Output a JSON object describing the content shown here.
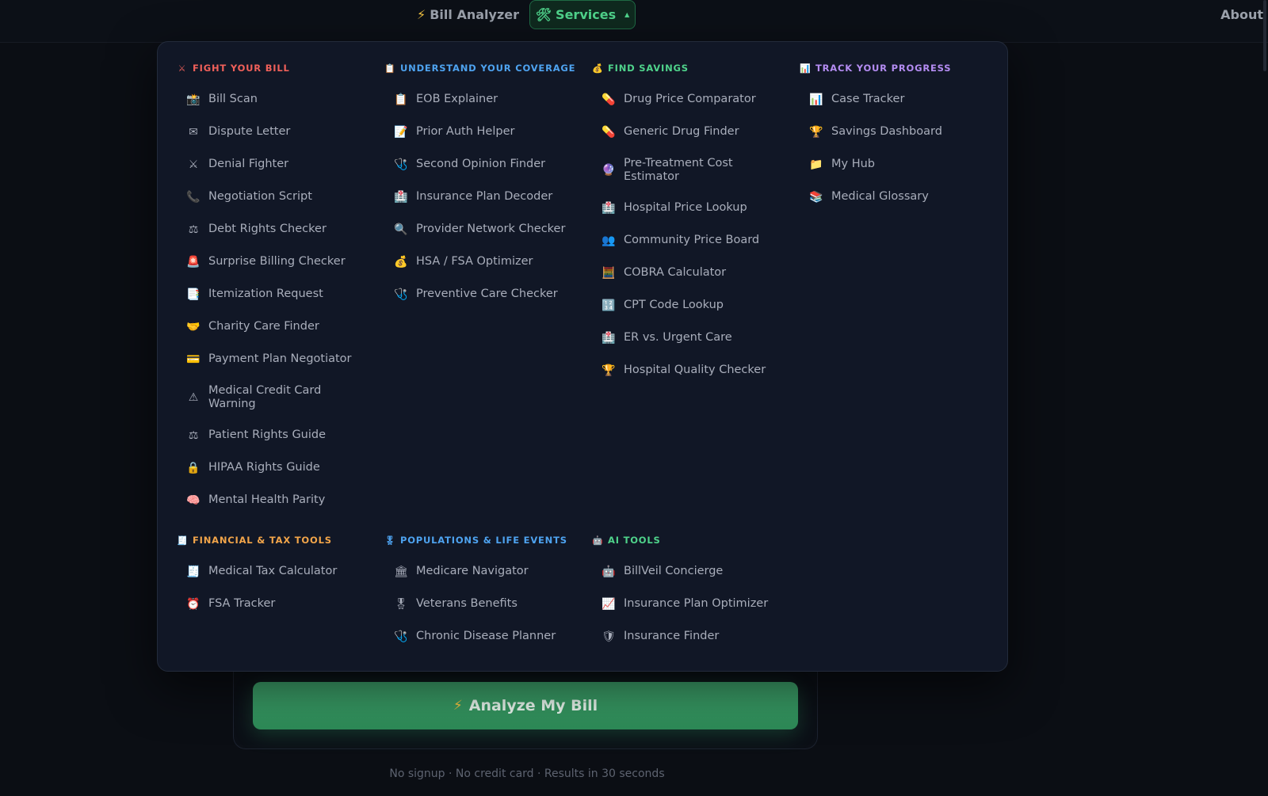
{
  "nav": {
    "bill_icon": "⚡",
    "bill_label": "Bill Analyzer",
    "services_icon": "🛠",
    "services_label": "Services",
    "about_label": "About"
  },
  "menu": {
    "fight": {
      "icon": "⚔",
      "title": "FIGHT YOUR BILL",
      "color": "#f0605a",
      "items": [
        {
          "icon": "📸",
          "label": "Bill Scan"
        },
        {
          "icon": "✉",
          "label": "Dispute Letter"
        },
        {
          "icon": "⚔",
          "label": "Denial Fighter"
        },
        {
          "icon": "📞",
          "label": "Negotiation Script"
        },
        {
          "icon": "⚖",
          "label": "Debt Rights Checker"
        },
        {
          "icon": "🚨",
          "label": "Surprise Billing Checker"
        },
        {
          "icon": "📑",
          "label": "Itemization Request"
        },
        {
          "icon": "🤝",
          "label": "Charity Care Finder"
        },
        {
          "icon": "💳",
          "label": "Payment Plan Negotiator"
        },
        {
          "icon": "⚠",
          "label": "Medical Credit Card Warning"
        },
        {
          "icon": "⚖",
          "label": "Patient Rights Guide"
        },
        {
          "icon": "🔒",
          "label": "HIPAA Rights Guide"
        },
        {
          "icon": "🧠",
          "label": "Mental Health Parity"
        }
      ]
    },
    "coverage": {
      "icon": "📋",
      "title": "UNDERSTAND YOUR COVERAGE",
      "color": "#4ea3f0",
      "items": [
        {
          "icon": "📋",
          "label": "EOB Explainer"
        },
        {
          "icon": "📝",
          "label": "Prior Auth Helper"
        },
        {
          "icon": "🩺",
          "label": "Second Opinion Finder"
        },
        {
          "icon": "🏥",
          "label": "Insurance Plan Decoder"
        },
        {
          "icon": "🔍",
          "label": "Provider Network Checker"
        },
        {
          "icon": "💰",
          "label": "HSA / FSA Optimizer"
        },
        {
          "icon": "🩺",
          "label": "Preventive Care Checker"
        }
      ]
    },
    "savings": {
      "icon": "💰",
      "title": "FIND SAVINGS",
      "color": "#4fd38b",
      "items": [
        {
          "icon": "💊",
          "label": "Drug Price Comparator"
        },
        {
          "icon": "💊",
          "label": "Generic Drug Finder"
        },
        {
          "icon": "🔮",
          "label": "Pre-Treatment Cost Estimator"
        },
        {
          "icon": "🏥",
          "label": "Hospital Price Lookup"
        },
        {
          "icon": "👥",
          "label": "Community Price Board"
        },
        {
          "icon": "🧮",
          "label": "COBRA Calculator"
        },
        {
          "icon": "🔢",
          "label": "CPT Code Lookup"
        },
        {
          "icon": "🏥",
          "label": "ER vs. Urgent Care"
        },
        {
          "icon": "🏆",
          "label": "Hospital Quality Checker"
        }
      ]
    },
    "progress": {
      "icon": "📊",
      "title": "TRACK YOUR PROGRESS",
      "color": "#b48cf2",
      "items": [
        {
          "icon": "📊",
          "label": "Case Tracker"
        },
        {
          "icon": "🏆",
          "label": "Savings Dashboard"
        },
        {
          "icon": "📁",
          "label": "My Hub"
        },
        {
          "icon": "📚",
          "label": "Medical Glossary"
        }
      ]
    },
    "tax": {
      "icon": "🧾",
      "title": "FINANCIAL & TAX TOOLS",
      "color": "#f2a54a",
      "items": [
        {
          "icon": "🧾",
          "label": "Medical Tax Calculator"
        },
        {
          "icon": "⏰",
          "label": "FSA Tracker"
        }
      ]
    },
    "populations": {
      "icon": "🎖",
      "title": "POPULATIONS & LIFE EVENTS",
      "color": "#4ea3f0",
      "items": [
        {
          "icon": "🏛",
          "label": "Medicare Navigator"
        },
        {
          "icon": "🎖",
          "label": "Veterans Benefits"
        },
        {
          "icon": "🩺",
          "label": "Chronic Disease Planner"
        }
      ]
    },
    "ai": {
      "icon": "🤖",
      "title": "AI TOOLS",
      "color": "#4fd38b",
      "items": [
        {
          "icon": "🤖",
          "label": "BillVeil Concierge"
        },
        {
          "icon": "📈",
          "label": "Insurance Plan Optimizer"
        },
        {
          "icon": "🛡",
          "label": "Insurance Finder"
        }
      ]
    }
  },
  "cta": {
    "icon": "⚡",
    "label": "Analyze My Bill",
    "subtext": "No signup · No credit card · Results in 30 seconds"
  }
}
